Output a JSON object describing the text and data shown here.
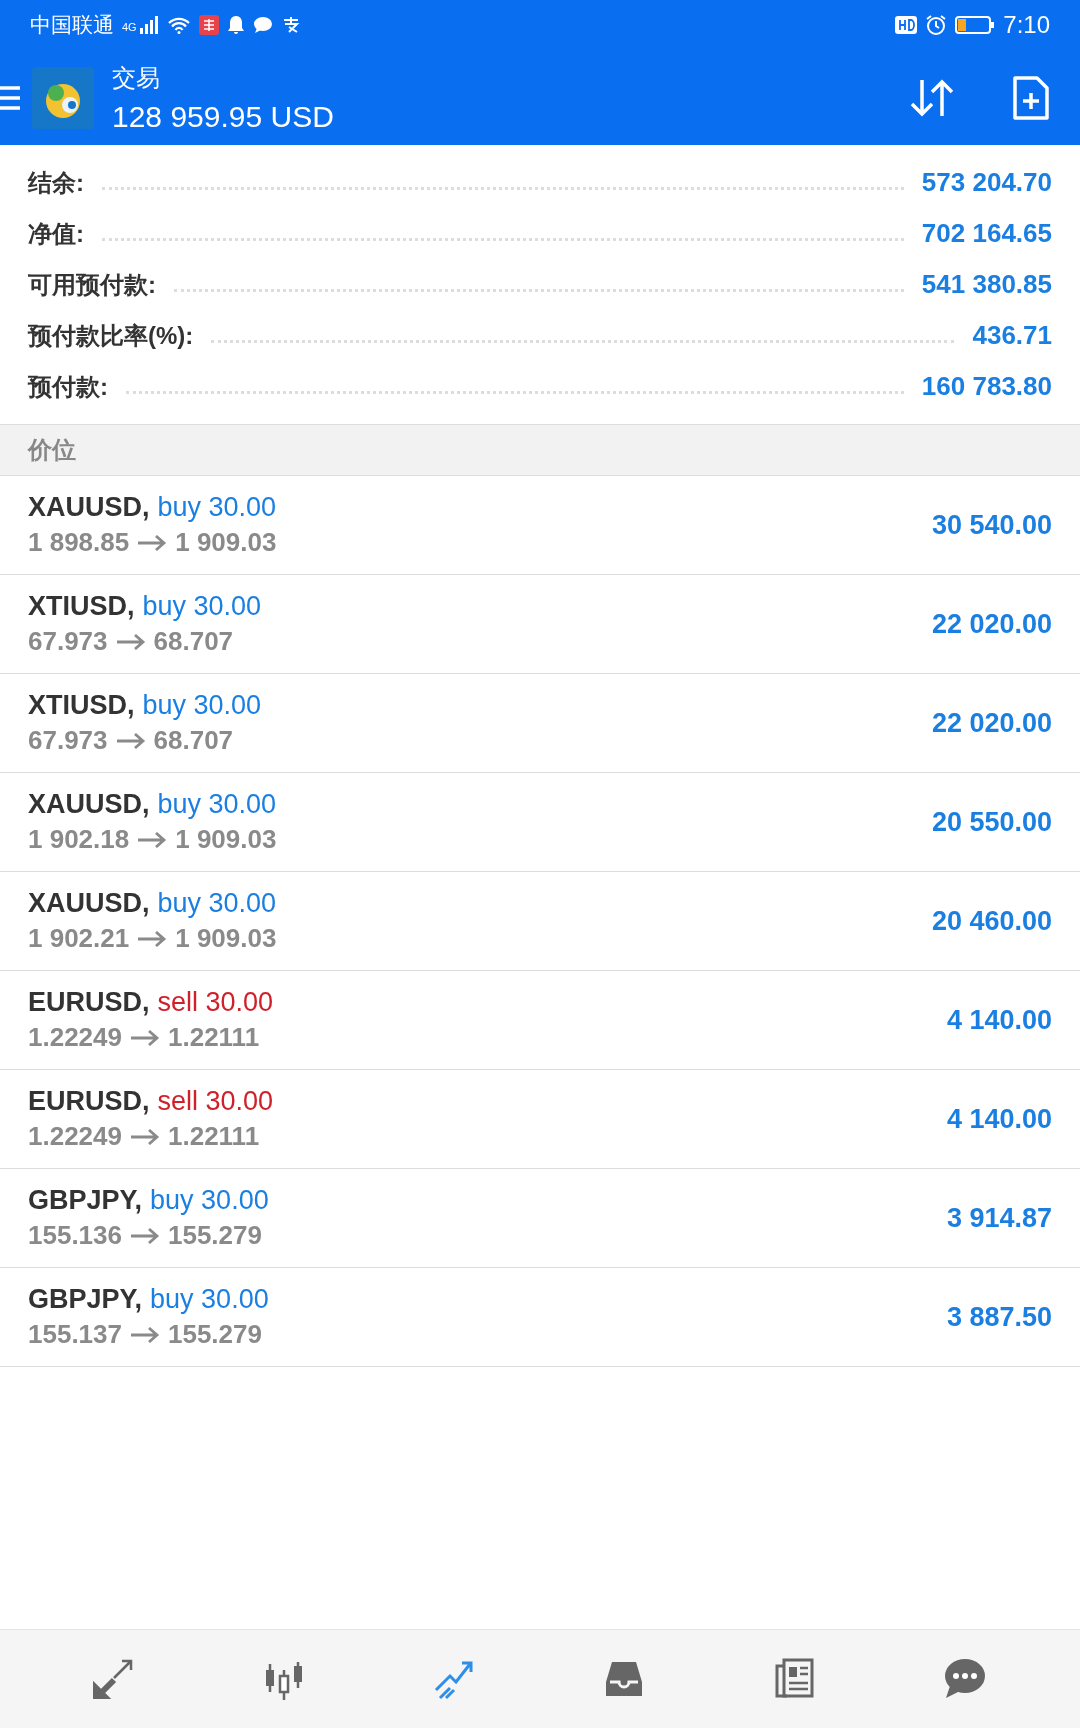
{
  "status_bar": {
    "carrier": "中国联通",
    "network": "4G",
    "time": "7:10"
  },
  "header": {
    "title": "交易",
    "balance": "128 959.95 USD"
  },
  "summary": [
    {
      "label": "结余:",
      "value": "573 204.70"
    },
    {
      "label": "净值:",
      "value": "702 164.65"
    },
    {
      "label": "可用预付款:",
      "value": "541 380.85"
    },
    {
      "label": "预付款比率(%):",
      "value": "436.71"
    },
    {
      "label": "预付款:",
      "value": "160 783.80"
    }
  ],
  "section_title": "价位",
  "positions": [
    {
      "symbol": "XAUUSD,",
      "kind": "buy",
      "order": "buy 30.00",
      "open": "1 898.85",
      "current": "1 909.03",
      "profit": "30 540.00"
    },
    {
      "symbol": "XTIUSD,",
      "kind": "buy",
      "order": "buy 30.00",
      "open": "67.973",
      "current": "68.707",
      "profit": "22 020.00"
    },
    {
      "symbol": "XTIUSD,",
      "kind": "buy",
      "order": "buy 30.00",
      "open": "67.973",
      "current": "68.707",
      "profit": "22 020.00"
    },
    {
      "symbol": "XAUUSD,",
      "kind": "buy",
      "order": "buy 30.00",
      "open": "1 902.18",
      "current": "1 909.03",
      "profit": "20 550.00"
    },
    {
      "symbol": "XAUUSD,",
      "kind": "buy",
      "order": "buy 30.00",
      "open": "1 902.21",
      "current": "1 909.03",
      "profit": "20 460.00"
    },
    {
      "symbol": "EURUSD,",
      "kind": "sell",
      "order": "sell 30.00",
      "open": "1.22249",
      "current": "1.22111",
      "profit": "4 140.00"
    },
    {
      "symbol": "EURUSD,",
      "kind": "sell",
      "order": "sell 30.00",
      "open": "1.22249",
      "current": "1.22111",
      "profit": "4 140.00"
    },
    {
      "symbol": "GBPJPY,",
      "kind": "buy",
      "order": "buy 30.00",
      "open": "155.136",
      "current": "155.279",
      "profit": "3 914.87"
    },
    {
      "symbol": "GBPJPY,",
      "kind": "buy",
      "order": "buy 30.00",
      "open": "155.137",
      "current": "155.279",
      "profit": "3 887.50"
    }
  ],
  "nav": [
    {
      "kind": "quotes",
      "selected": false
    },
    {
      "kind": "chart",
      "selected": false
    },
    {
      "kind": "trade",
      "selected": true
    },
    {
      "kind": "history",
      "selected": false
    },
    {
      "kind": "news",
      "selected": false
    },
    {
      "kind": "chat",
      "selected": false
    }
  ]
}
